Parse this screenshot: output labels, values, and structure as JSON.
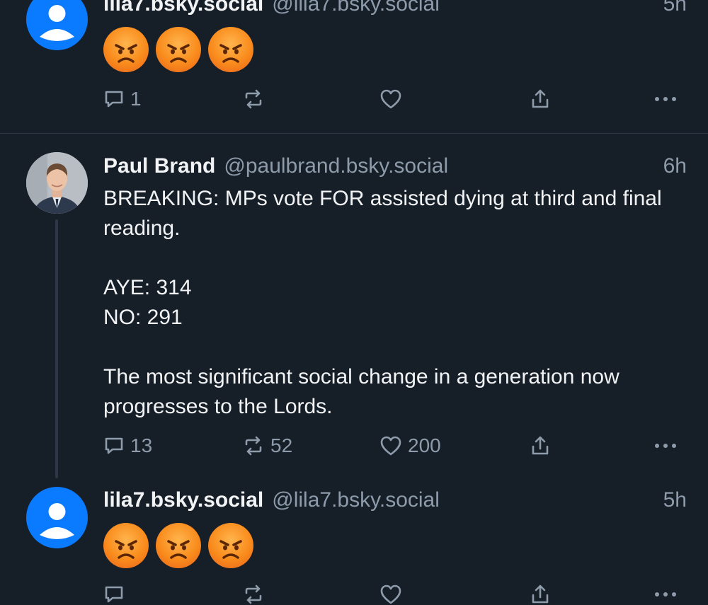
{
  "posts": [
    {
      "display_name": "lila7.bsky.social",
      "handle": "@lila7.bsky.social",
      "time": "5h",
      "emojis": [
        "angry-face",
        "angry-face",
        "angry-face"
      ],
      "replies": "1",
      "reposts": "",
      "likes": ""
    },
    {
      "display_name": "Paul Brand",
      "handle": "@paulbrand.bsky.social",
      "time": "6h",
      "text": "BREAKING: MPs vote FOR assisted dying at third and final reading.\n\nAYE: 314\nNO: 291\n\nThe most significant social change in a generation now progresses to the Lords.",
      "replies": "13",
      "reposts": "52",
      "likes": "200"
    },
    {
      "display_name": "lila7.bsky.social",
      "handle": "@lila7.bsky.social",
      "time": "5h",
      "emojis": [
        "angry-face",
        "angry-face",
        "angry-face"
      ],
      "replies": "",
      "reposts": "",
      "likes": ""
    }
  ],
  "icons": {
    "reply": "reply-icon",
    "repost": "repost-icon",
    "like": "like-icon",
    "share": "share-icon",
    "more": "more-icon"
  },
  "colors": {
    "background": "#161e27",
    "text": "#f1f3f5",
    "muted": "#8d9bab",
    "divider": "#2c3845",
    "avatar_default": "#0a7aff"
  }
}
